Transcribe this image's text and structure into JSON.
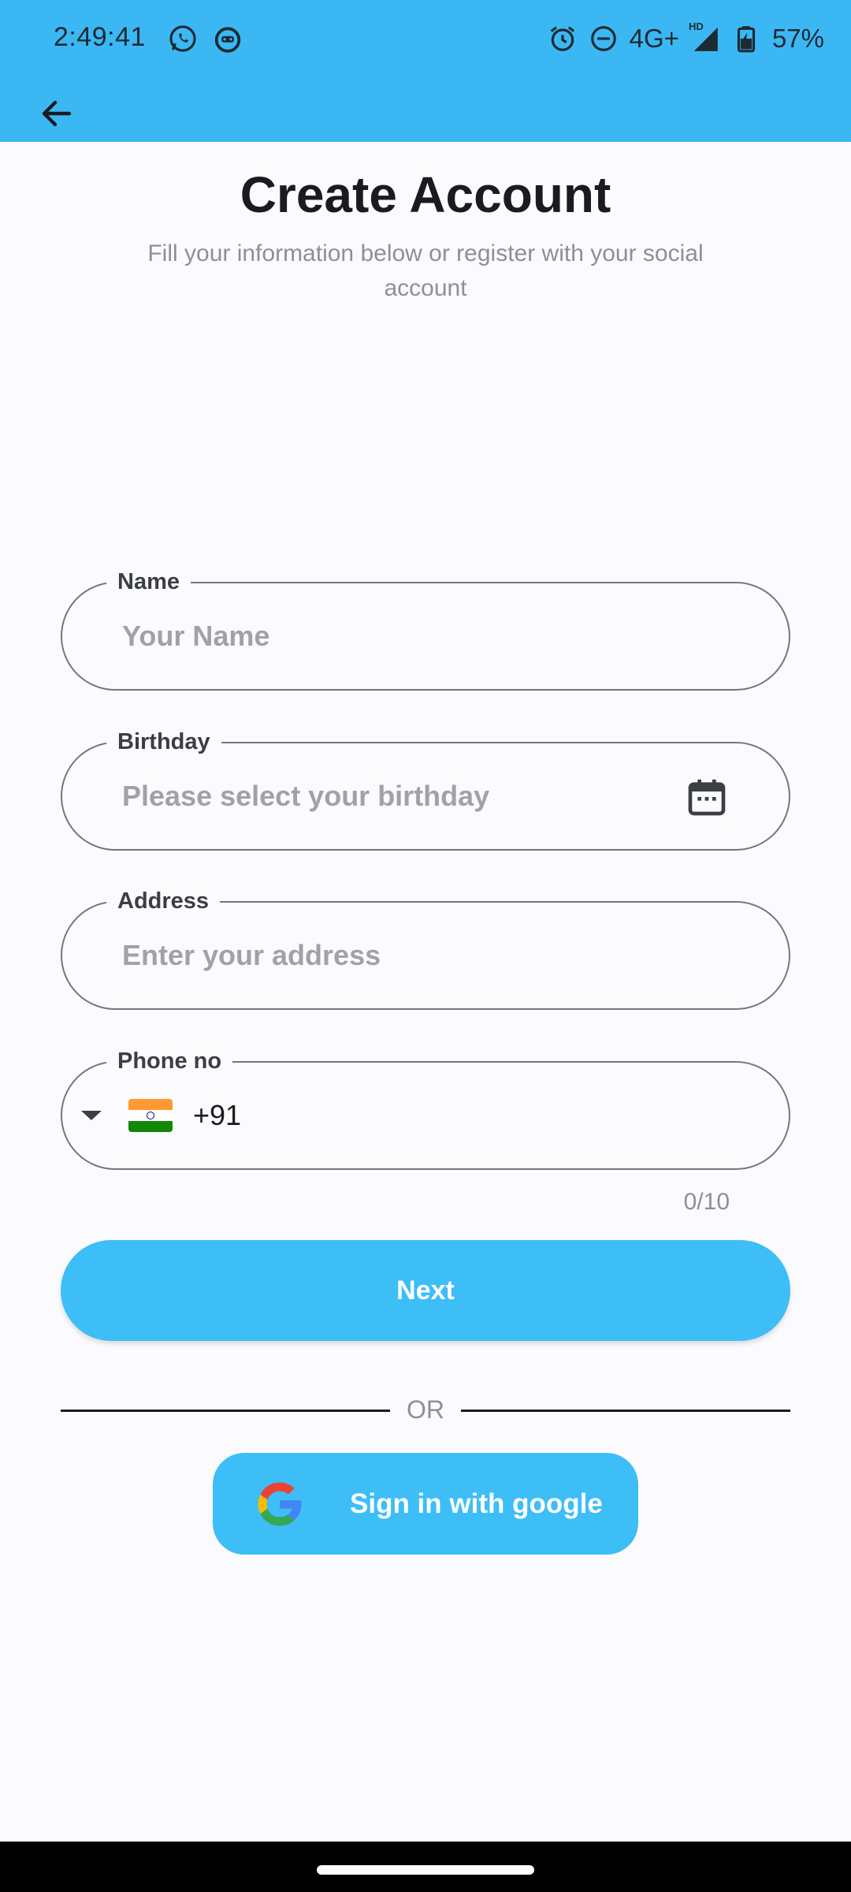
{
  "status_bar": {
    "time": "2:49:41",
    "network": "4G+",
    "network_hd": "HD",
    "battery": "57%",
    "icons": [
      "whatsapp-icon",
      "notification-app-icon",
      "alarm-icon",
      "do-not-disturb-icon",
      "signal-icon",
      "battery-charging-icon"
    ]
  },
  "app_bar": {
    "back_icon": "arrow-left-icon"
  },
  "header": {
    "title": "Create Account",
    "subtitle": "Fill your information below or register with your social account"
  },
  "form": {
    "name": {
      "label": "Name",
      "placeholder": "Your Name"
    },
    "birthday": {
      "label": "Birthday",
      "placeholder": "Please select your birthday",
      "icon": "calendar-icon"
    },
    "address": {
      "label": "Address",
      "placeholder": "Enter your address"
    },
    "phone": {
      "label": "Phone no",
      "country_code": "+91",
      "flag": "india-flag-icon",
      "counter": "0/10"
    }
  },
  "actions": {
    "next_label": "Next",
    "divider_label": "OR",
    "google_label": "Sign in with google"
  },
  "colors": {
    "primary": "#3dbef7",
    "app_bar": "#3bb8f3",
    "background": "#fbfbfe",
    "outline": "#74777f",
    "placeholder": "#a0a2a8"
  }
}
